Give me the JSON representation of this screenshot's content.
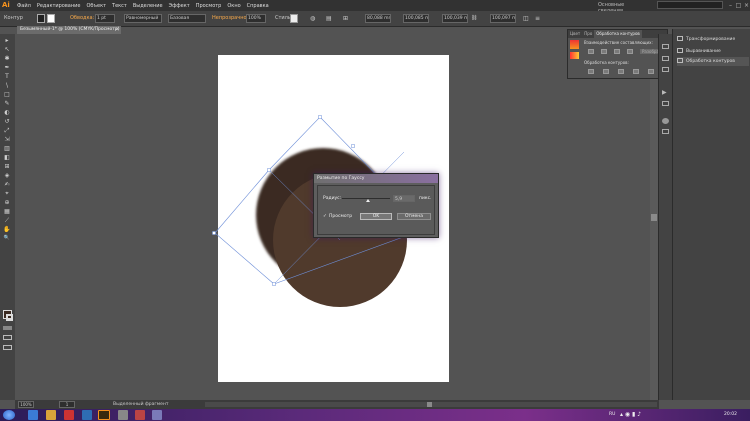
{
  "app": {
    "logo": "Ai"
  },
  "menu": [
    "Файл",
    "Редактирование",
    "Объект",
    "Текст",
    "Выделение",
    "Эффект",
    "Просмотр",
    "Окно",
    "Справка"
  ],
  "workspace": "Основные сведения",
  "window_controls": [
    "–",
    "□",
    "×"
  ],
  "control_bar": {
    "object_type": "Контур",
    "stroke_label": "Обводка:",
    "stroke_weight": "1 pt",
    "profile": "Равномерный",
    "brush": "Базовая",
    "opacity_label": "Непрозрачность:",
    "opacity": "100%",
    "style_label": "Стиль:",
    "x": "80,088 mm",
    "y": "100,085 mm",
    "w": "100,039 mm",
    "h": "100,097 mm"
  },
  "document_tab": {
    "title": "Безымянный-1* @ 100% (CMYK/Просмотр)",
    "close": "×"
  },
  "tools": [
    "▸",
    "↖",
    "✱",
    "✒",
    "T",
    "\\",
    "□",
    "✎",
    "◐",
    "↺",
    "⤢",
    "⇲",
    "▥",
    "◧",
    "⊞",
    "◈",
    "✍",
    "⌖",
    "⊕",
    "▦",
    "⟋",
    "✋",
    "🔍"
  ],
  "right_panel_top": {
    "tabs": [
      "Цвет",
      "Про",
      "Обработка контуров"
    ],
    "shape_modes_label": "Взаимодействие составляющих:",
    "expand_button": "Разобрать",
    "pathfinder_label": "Обработка контуров:"
  },
  "right_panel_side": {
    "items": [
      "Трансформирование",
      "Выравнивание",
      "Обработка контуров"
    ]
  },
  "dialog": {
    "title": "Размытие по Гауссу",
    "radius_label": "Радиус:",
    "radius_value": "5,9",
    "unit": "пикс.",
    "preview_label": "Просмотр",
    "preview_check": "✓",
    "ok": "OK",
    "cancel": "Отмена",
    "slider_fraction": 0.55
  },
  "status_bar": {
    "zoom": "100%",
    "page": "1",
    "status": "Выделенный фрагмент"
  },
  "taskbar": {
    "lang": "RU",
    "time": "20:02"
  },
  "colors": {
    "circle_fill": "#503a2c",
    "shadow_fill": "#3b2a21",
    "selection_blue": "#6e8fd8",
    "accent_orange": "#f7931e"
  }
}
